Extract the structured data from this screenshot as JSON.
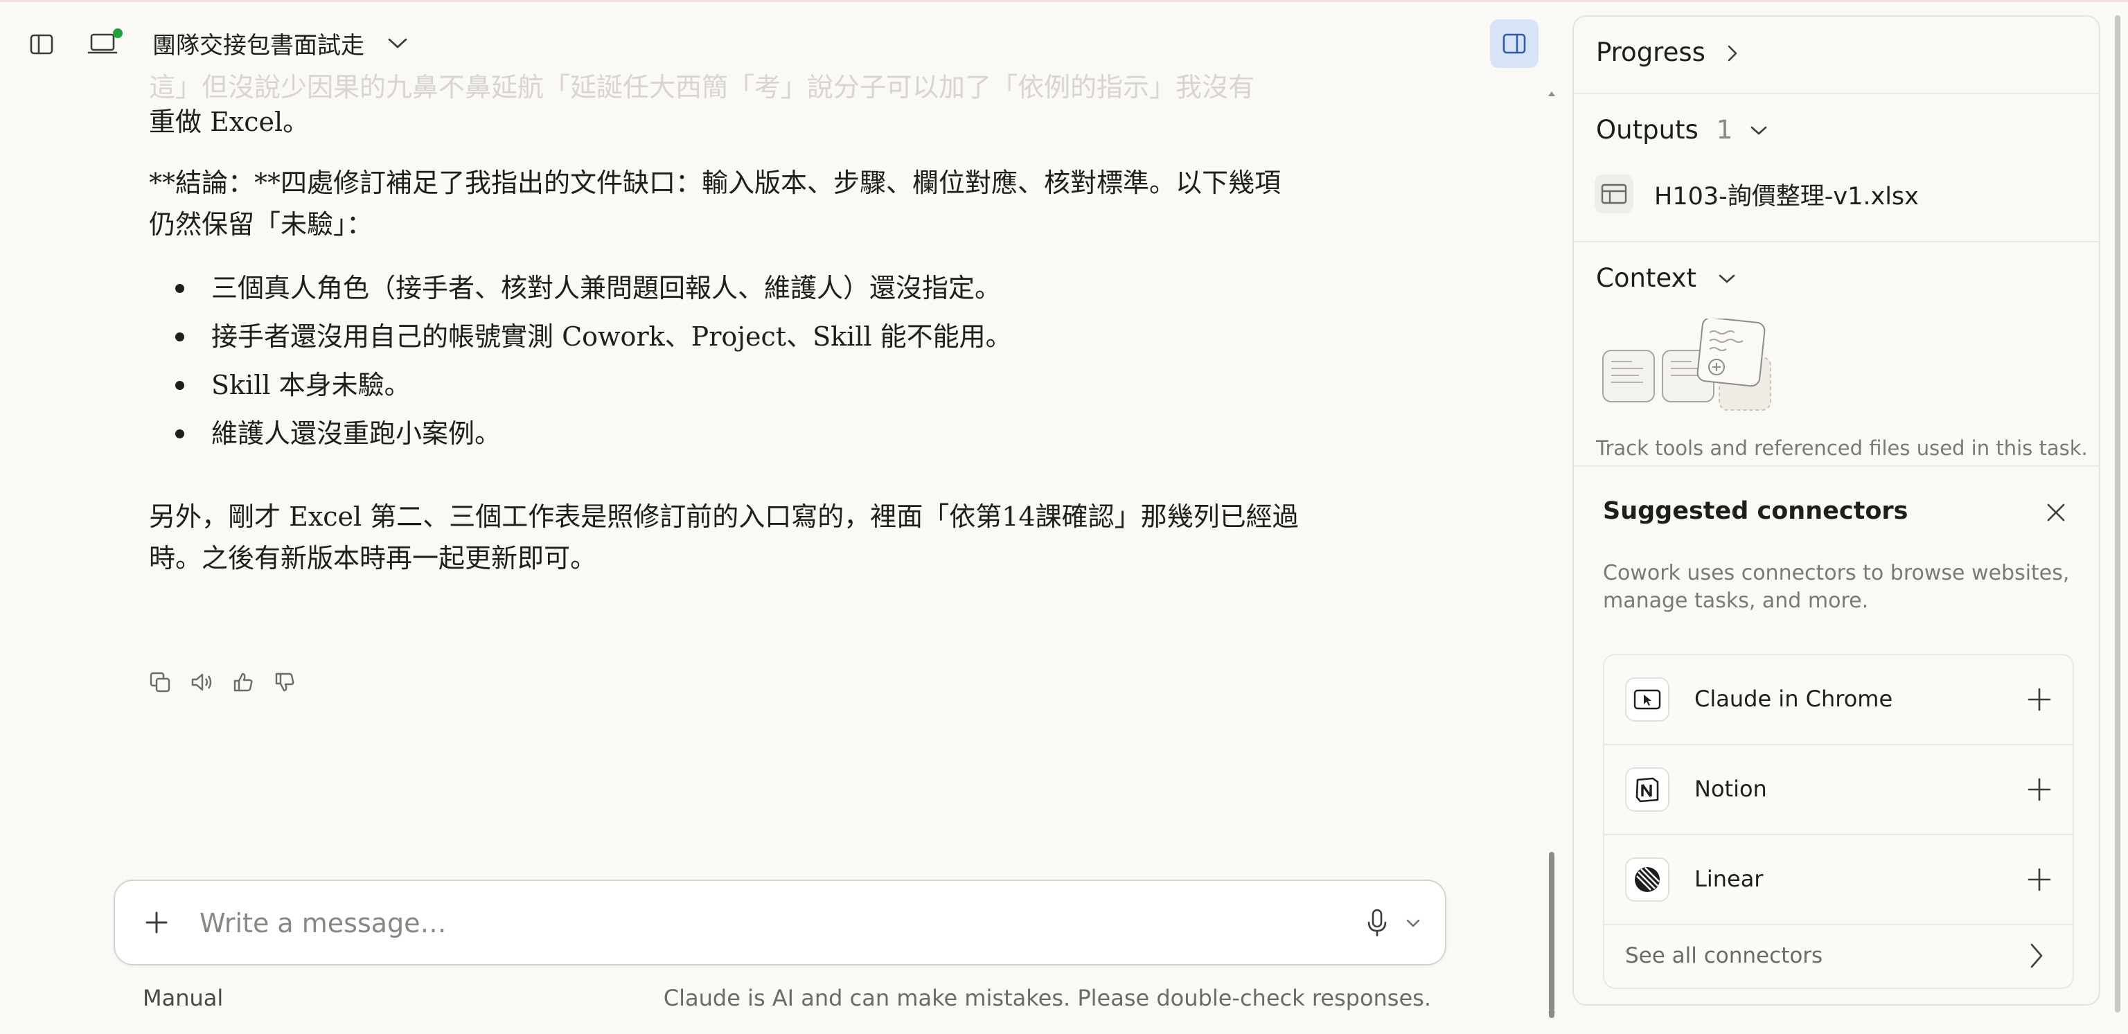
{
  "window": {
    "task_title": "團隊交接包書面試走"
  },
  "chat": {
    "faded_line": "這」但沒說少因果的九鼻不鼻延航「延誕任大西簡「考」說分子可以加了「依例的指示」我沒有",
    "para1_line2": "重做 Excel。",
    "conclusion_line1": "**結論：**四處修訂補足了我指出的文件缺口：輸入版本、步驟、欄位對應、核對標準。以下幾項",
    "conclusion_line2": "仍然保留「未驗」：",
    "bullets": [
      "三個真人角色（接手者、核對人兼問題回報人、維護人）還沒指定。",
      "接手者還沒用自己的帳號實測 Cowork、Project、Skill 能不能用。",
      "Skill 本身未驗。",
      "維護人還沒重跑小案例。"
    ],
    "closing_line1": "另外，剛才 Excel 第二、三個工作表是照修訂前的入口寫的，裡面「依第14課確認」那幾列已經過",
    "closing_line2": "時。之後有新版本時再一起更新即可。",
    "action_icons": [
      "copy-icon",
      "speaker-icon",
      "thumbs-up-icon",
      "thumbs-down-icon"
    ]
  },
  "composer": {
    "placeholder": "Write a message…",
    "value": "",
    "mode_label": "Manual",
    "disclaimer": "Claude is AI and can make mistakes. Please double-check responses."
  },
  "panel": {
    "progress_label": "Progress",
    "outputs_label": "Outputs",
    "outputs_count": "1",
    "output_file": "H103-詢價整理-v1.xlsx",
    "context_label": "Context",
    "context_note": "Track tools and referenced files used in this task.",
    "connectors": {
      "title": "Suggested connectors",
      "description": "Cowork uses connectors to browse websites, manage tasks, and more.",
      "items": [
        {
          "name": "Claude in Chrome",
          "icon": "chrome-cursor-icon"
        },
        {
          "name": "Notion",
          "icon": "notion-icon"
        },
        {
          "name": "Linear",
          "icon": "linear-icon"
        }
      ],
      "see_all": "See all connectors"
    }
  },
  "colors": {
    "background": "#faf9f5",
    "panel_toggle_active": "#d7e3f7",
    "status_dot": "#22a33a"
  }
}
